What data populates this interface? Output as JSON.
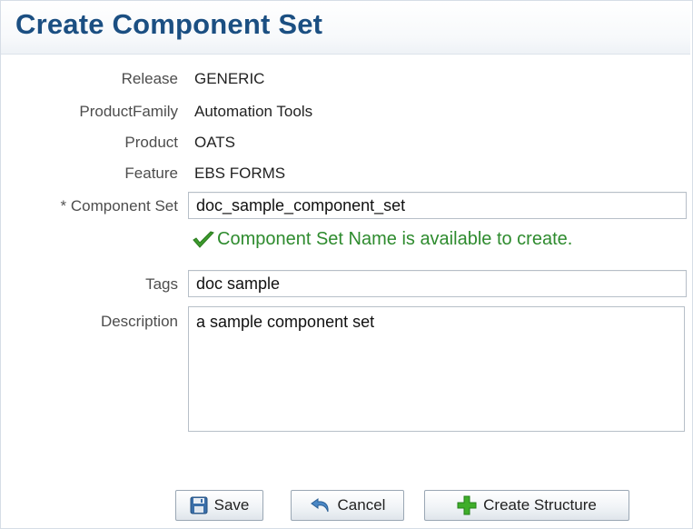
{
  "page": {
    "title": "Create Component Set"
  },
  "form": {
    "release_label": "Release",
    "release_value": "GENERIC",
    "product_family_label": "ProductFamily",
    "product_family_value": "Automation Tools",
    "product_label": "Product",
    "product_value": "OATS",
    "feature_label": "Feature",
    "feature_value": "EBS FORMS",
    "component_set_required_mark": "*",
    "component_set_label": "Component Set",
    "component_set_value": "doc_sample_component_set",
    "availability_message": "Component Set Name is available to create.",
    "tags_label": "Tags",
    "tags_value": "doc sample",
    "description_label": "Description",
    "description_value": "a sample component set"
  },
  "buttons": {
    "save_label": "Save",
    "cancel_label": "Cancel",
    "create_structure_label": "Create Structure"
  },
  "icons": {
    "status": "checkmark-icon",
    "save": "floppy-disk-icon",
    "cancel": "undo-icon",
    "create_structure": "plus-icon"
  },
  "colors": {
    "title": "#1b4f82",
    "success": "#2e8b2e",
    "label": "#4d4d4d",
    "input_border": "#b7bfc8"
  }
}
